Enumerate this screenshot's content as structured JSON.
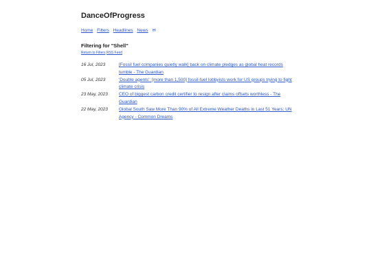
{
  "site": {
    "title": "DanceOfProgress"
  },
  "nav": {
    "items": [
      "Home",
      "Filters",
      "Headlines",
      "News"
    ],
    "mail_icon": "✉"
  },
  "filter": {
    "heading": "Filtering for \"Shell\"",
    "return_link": "Return to Filters",
    "rss_link": "RSS Feed"
  },
  "entries": [
    {
      "date": "16 Jul, 2023",
      "title": "[Fossil fuel companies quietly walk] back on climate pledges as global heat records tumble - The Guardian"
    },
    {
      "date": "05 Jul, 2023",
      "title": "'Double agents': [more than 1,500] fossil-fuel lobbyists work for US groups trying to fight climate crisis"
    },
    {
      "date": "23 May, 2023",
      "title": "CEO of biggest carbon credit certifier to resign after claims offsets worthless - The Guardian"
    },
    {
      "date": "22 May, 2023",
      "title": "Global South Saw More Than 90% of All Extreme Weather Deaths in Last 51 Years: UN Agency - Common Dreams"
    }
  ],
  "colors": {
    "link": "#2a55c9",
    "text": "#222222",
    "background": "#ffffff"
  }
}
